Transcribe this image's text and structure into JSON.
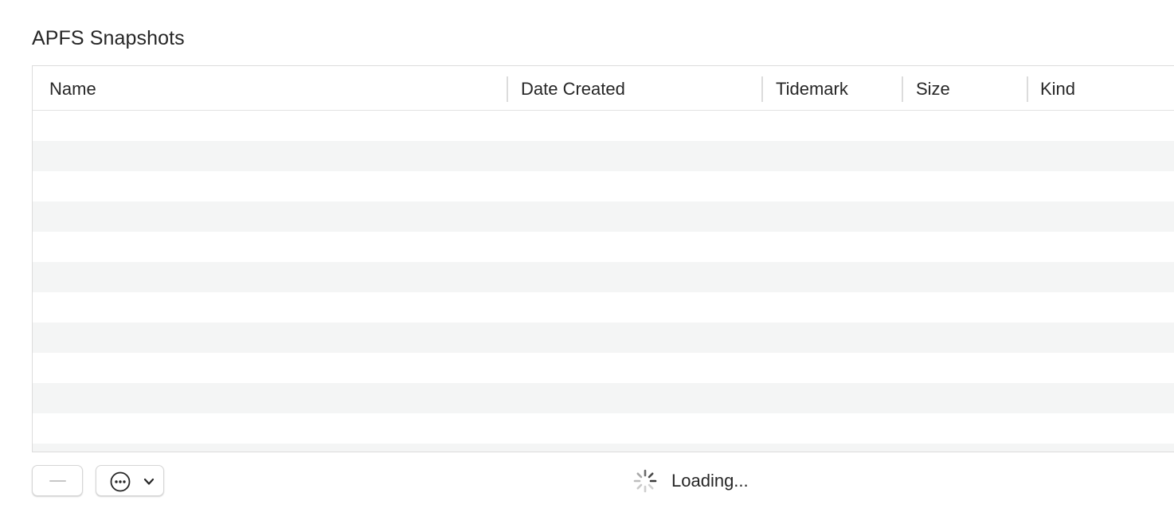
{
  "section": {
    "title": "APFS Snapshots"
  },
  "table": {
    "columns": [
      {
        "label": "Name"
      },
      {
        "label": "Date Created"
      },
      {
        "label": "Tidemark"
      },
      {
        "label": "Size"
      },
      {
        "label": "Kind"
      }
    ],
    "rows": []
  },
  "toolbar": {
    "remove_button_icon": "minus-icon",
    "more_button_icon": "ellipsis-circle-icon",
    "more_button_menu_icon": "chevron-down-icon"
  },
  "status": {
    "icon": "spinner-icon",
    "text": "Loading..."
  },
  "colors": {
    "alt_row": "#f4f5f5",
    "border": "#dcdcdc",
    "text": "#262626"
  }
}
